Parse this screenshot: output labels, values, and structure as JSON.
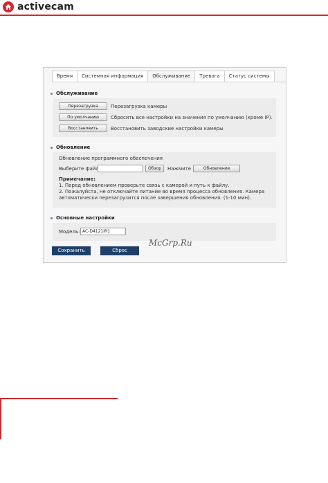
{
  "brand": {
    "name": "activecam"
  },
  "tabs": [
    "Время",
    "Системная информация",
    "Обслуживание",
    "Тревога",
    "Статус системы"
  ],
  "active_tab": "Обслуживание",
  "maintenance": {
    "title": "Обслуживание",
    "reboot_button": "Перезагрузка",
    "reboot_desc": "Перезагрузка камеры",
    "default_button": "По умолчанию",
    "default_desc": "Сбросить все настройки на значения по умолчанию (кроме IP).",
    "restore_button": "Восстановить",
    "restore_desc": "Восстановить заводские настройки камеры"
  },
  "update": {
    "title": "Обновление",
    "subtitle": "Обновление программного обеспечения",
    "file_label": "Выберите файл:",
    "file_value": "",
    "browse_button": "Обзор",
    "press_label": "Нажмите",
    "update_button": "Обновление",
    "note_title": "Примечание:",
    "note_line1": "1. Перед обновлением проверьте связь с камерой и путь к файлу.",
    "note_line2": "2. Пожалуйста, не отключайте питание во время процесса обновления. Камера",
    "note_line3": "автоматически перезагрузится после завершения обновления. (1-10 мин)."
  },
  "basic": {
    "title": "Основные настройки",
    "model_label": "Модель:",
    "model_value": "AC-D4121IR1"
  },
  "actions": {
    "save": "Сохранить",
    "reset": "Сброс"
  },
  "watermark": "McGrp.Ru",
  "colors": {
    "brand_red": "#d7262f",
    "button_dark": "#1e3f67"
  }
}
